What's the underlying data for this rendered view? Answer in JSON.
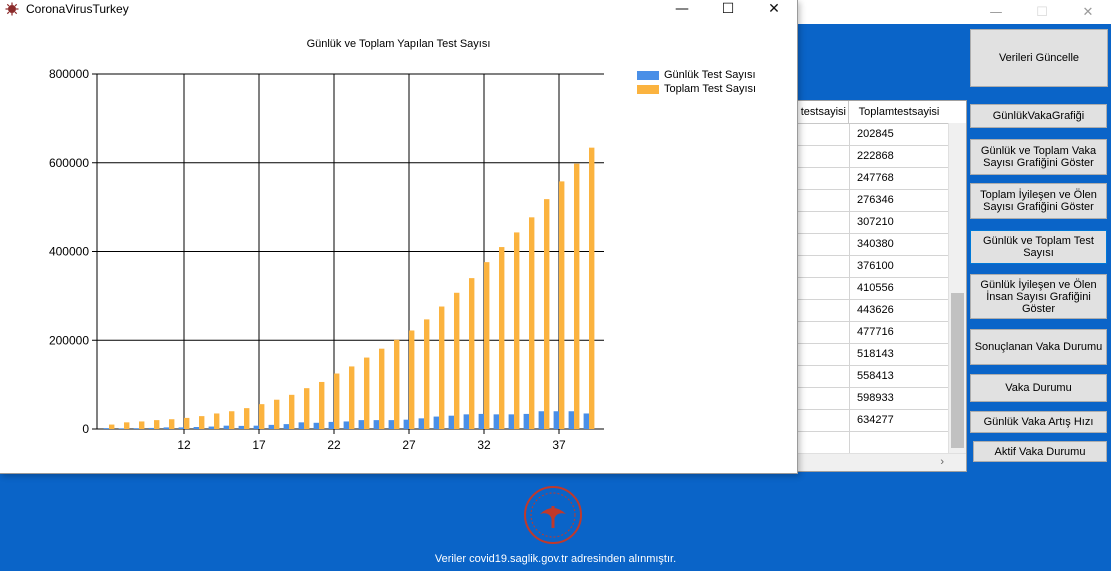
{
  "main_window": {
    "controls": {
      "minimize": "—",
      "maximize": "☐",
      "close": "✕"
    }
  },
  "grid": {
    "header_col1": "testsayisi",
    "header_col2": "Toplamtestsayisi",
    "rows": [
      "202845",
      "222868",
      "247768",
      "276346",
      "307210",
      "340380",
      "376100",
      "410556",
      "443626",
      "477716",
      "518143",
      "558413",
      "598933",
      "634277",
      ""
    ],
    "hscroll_arrow": "›"
  },
  "buttons": {
    "update": "Verileri Güncelle",
    "daily_case_chart": "GünlükVakaGrafiği",
    "daily_total_case_chart": "Günlük ve Toplam Vaka Sayısı Grafiğini Göster",
    "recovered_dead_chart": "Toplam İyileşen ve Ölen Sayısı Grafiğini Göster",
    "daily_total_test": "Günlük ve Toplam Test Sayısı",
    "daily_recovered_dead_chart": "Günlük İyileşen ve Ölen İnsan Sayısı Grafiğini Göster",
    "concluded_case_status": "Sonuçlanan Vaka Durumu",
    "case_status": "Vaka Durumu",
    "daily_case_increase": "Günlük Vaka Artış Hızı",
    "active_case_status": "Aktif Vaka Durumu"
  },
  "footer": {
    "text": "Veriler covid19.saglik.gov.tr adresinden alınmıştır."
  },
  "chart_window": {
    "title": "CoronaVirusTurkey",
    "controls": {
      "minimize": "—",
      "maximize": "☐",
      "close": "✕"
    }
  },
  "colors": {
    "daily": "#4a8fe7",
    "total": "#fbb33f",
    "background": "#0a64c8"
  },
  "chart_data": {
    "type": "bar",
    "title": "Günlük ve Toplam Yapılan Test Sayısı",
    "xlabel": "",
    "ylabel": "",
    "x": [
      7,
      8,
      9,
      10,
      11,
      12,
      13,
      14,
      15,
      16,
      17,
      18,
      19,
      20,
      21,
      22,
      23,
      24,
      25,
      26,
      27,
      28,
      29,
      30,
      31,
      32,
      33,
      34,
      35,
      36,
      37,
      38,
      39
    ],
    "xticks": [
      12,
      17,
      22,
      27,
      32,
      37
    ],
    "xlim": [
      6.2,
      40
    ],
    "ylim": [
      0,
      800000
    ],
    "yticks": [
      0,
      200000,
      400000,
      600000,
      800000
    ],
    "grid": true,
    "legend_position": "top-right",
    "series": [
      {
        "name": "Günlük Test Sayısı",
        "values": [
          2000,
          1500,
          1800,
          2400,
          3600,
          3600,
          4500,
          5500,
          7500,
          7000,
          7500,
          9300,
          11000,
          15000,
          14000,
          16000,
          17000,
          20000,
          20000,
          20000,
          21000,
          24000,
          28000,
          30000,
          33000,
          34000,
          33000,
          33000,
          34000,
          40000,
          40000,
          40000,
          35000
        ]
      },
      {
        "name": "Toplam Test Sayısı",
        "values": [
          10000,
          15000,
          17000,
          20000,
          22000,
          25000,
          29000,
          35000,
          40000,
          47000,
          56000,
          66000,
          77000,
          92000,
          106000,
          125000,
          141000,
          161000,
          181000,
          201000,
          222000,
          247000,
          276000,
          307000,
          340000,
          376000,
          410000,
          443000,
          477000,
          518000,
          558000,
          598000,
          634000
        ]
      }
    ]
  }
}
